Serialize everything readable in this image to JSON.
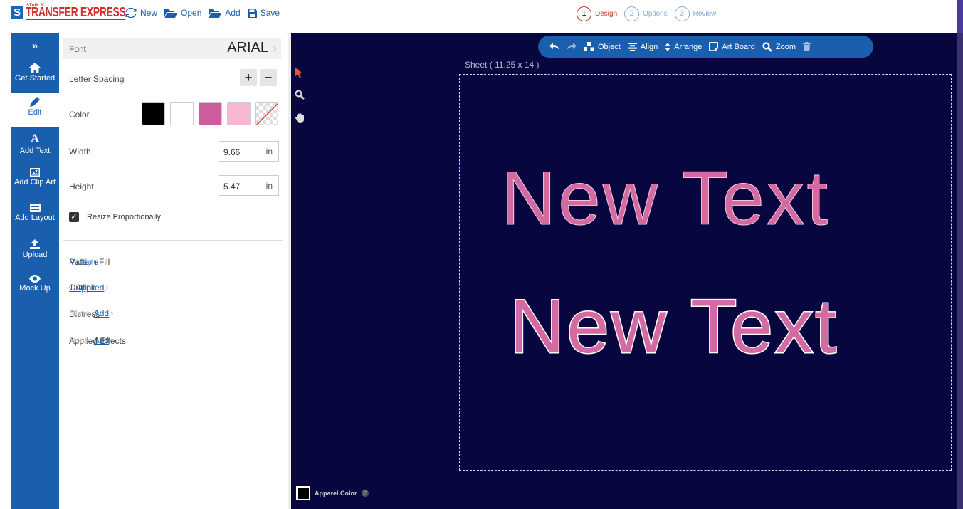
{
  "brand": {
    "small": "STAHLS'",
    "main": "TRANSFER EXPRESS",
    "mark": "S"
  },
  "file_actions": {
    "new": "New",
    "open": "Open",
    "add": "Add",
    "save": "Save"
  },
  "steps": [
    {
      "num": "1",
      "label": "Design"
    },
    {
      "num": "2",
      "label": "Options"
    },
    {
      "num": "3",
      "label": "Review"
    }
  ],
  "sidebar": {
    "toggle": "»",
    "items": [
      {
        "label": "Get Started"
      },
      {
        "label": "Edit"
      },
      {
        "label": "Add Text"
      },
      {
        "label": "Add Clip Art"
      },
      {
        "label": "Add Layout"
      },
      {
        "label": "Upload"
      },
      {
        "label": "Mock Up"
      }
    ]
  },
  "panel": {
    "font_label": "Font",
    "font_value": "ARIAL",
    "letter_spacing_label": "Letter Spacing",
    "color_label": "Color",
    "swatches": [
      "#000000",
      "#ffffff",
      "#cc5c9c",
      "#f5b7d2",
      "none"
    ],
    "width_label": "Width",
    "width_value": "9.66",
    "width_unit": "in",
    "height_label": "Height",
    "height_value": "5.47",
    "height_unit": "in",
    "resize_label": "Resize Proportionally",
    "resize_checked": true,
    "pattern_fill_label": "Pattern Fill",
    "pattern_fill_value": "Multiple",
    "outline_label": "Outline",
    "outline_value": "1 Applied",
    "distress_label": "Distress",
    "distress_none": "None",
    "distress_add": "Add",
    "effects_label": "Applied Effects",
    "effects_none": "None",
    "effects_add": "Add"
  },
  "toolbar": {
    "object": "Object",
    "align": "Align",
    "arrange": "Arrange",
    "artboard": "Art Board",
    "zoom": "Zoom"
  },
  "canvas": {
    "sheet_label": "Sheet ( 11.25 x 14 )",
    "text_1": "New Text",
    "text_2": "New Text",
    "apparel_label": "Apparel Color",
    "bg_color": "#07063f"
  }
}
